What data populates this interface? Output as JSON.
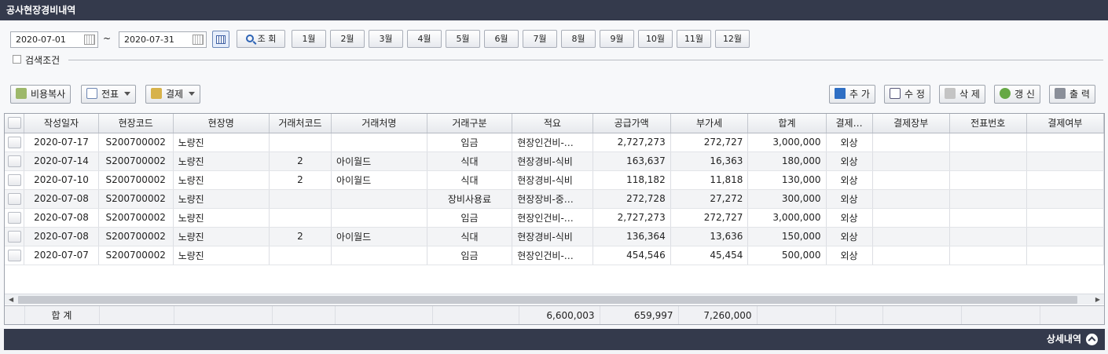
{
  "title": "공사현장경비내역",
  "filter": {
    "date_from": "2020-07-01",
    "date_to": "2020-07-31",
    "tilde": "~",
    "search_label": "조 회",
    "months": [
      "1월",
      "2월",
      "3월",
      "4월",
      "5월",
      "6월",
      "7월",
      "8월",
      "9월",
      "10월",
      "11월",
      "12월"
    ],
    "condition_label": "검색조건"
  },
  "toolbar": {
    "copy_label": "비용복사",
    "voucher_label": "전표",
    "payment_label": "결제",
    "add_label": "추 가",
    "edit_label": "수 정",
    "delete_label": "삭 제",
    "refresh_label": "갱 신",
    "print_label": "출 력"
  },
  "grid": {
    "columns": [
      "작성일자",
      "현장코드",
      "현장명",
      "거래처코드",
      "거래처명",
      "거래구분",
      "적요",
      "공급가액",
      "부가세",
      "합계",
      "결제…",
      "결제장부",
      "전표번호",
      "결제여부"
    ],
    "rows": [
      [
        "2020-07-17",
        "S200700002",
        "노량진",
        "",
        "",
        "임금",
        "현장인건비-…",
        "2,727,273",
        "272,727",
        "3,000,000",
        "외상",
        "",
        "",
        ""
      ],
      [
        "2020-07-14",
        "S200700002",
        "노량진",
        "2",
        "아이월드",
        "식대",
        "현장경비-식비",
        "163,637",
        "16,363",
        "180,000",
        "외상",
        "",
        "",
        ""
      ],
      [
        "2020-07-10",
        "S200700002",
        "노량진",
        "2",
        "아이월드",
        "식대",
        "현장경비-식비",
        "118,182",
        "11,818",
        "130,000",
        "외상",
        "",
        "",
        ""
      ],
      [
        "2020-07-08",
        "S200700002",
        "노량진",
        "",
        "",
        "장비사용료",
        "현장장비-중…",
        "272,728",
        "27,272",
        "300,000",
        "외상",
        "",
        "",
        ""
      ],
      [
        "2020-07-08",
        "S200700002",
        "노량진",
        "",
        "",
        "임금",
        "현장인건비-…",
        "2,727,273",
        "272,727",
        "3,000,000",
        "외상",
        "",
        "",
        ""
      ],
      [
        "2020-07-08",
        "S200700002",
        "노량진",
        "2",
        "아이월드",
        "식대",
        "현장경비-식비",
        "136,364",
        "13,636",
        "150,000",
        "외상",
        "",
        "",
        ""
      ],
      [
        "2020-07-07",
        "S200700002",
        "노량진",
        "",
        "",
        "임금",
        "현장인건비-…",
        "454,546",
        "45,454",
        "500,000",
        "외상",
        "",
        "",
        ""
      ]
    ],
    "footer": {
      "label": "합 계",
      "supply_total": "6,600,003",
      "vat_total": "659,997",
      "sum_total": "7,260,000"
    }
  },
  "bottom": {
    "detail_label": "상세내역"
  }
}
